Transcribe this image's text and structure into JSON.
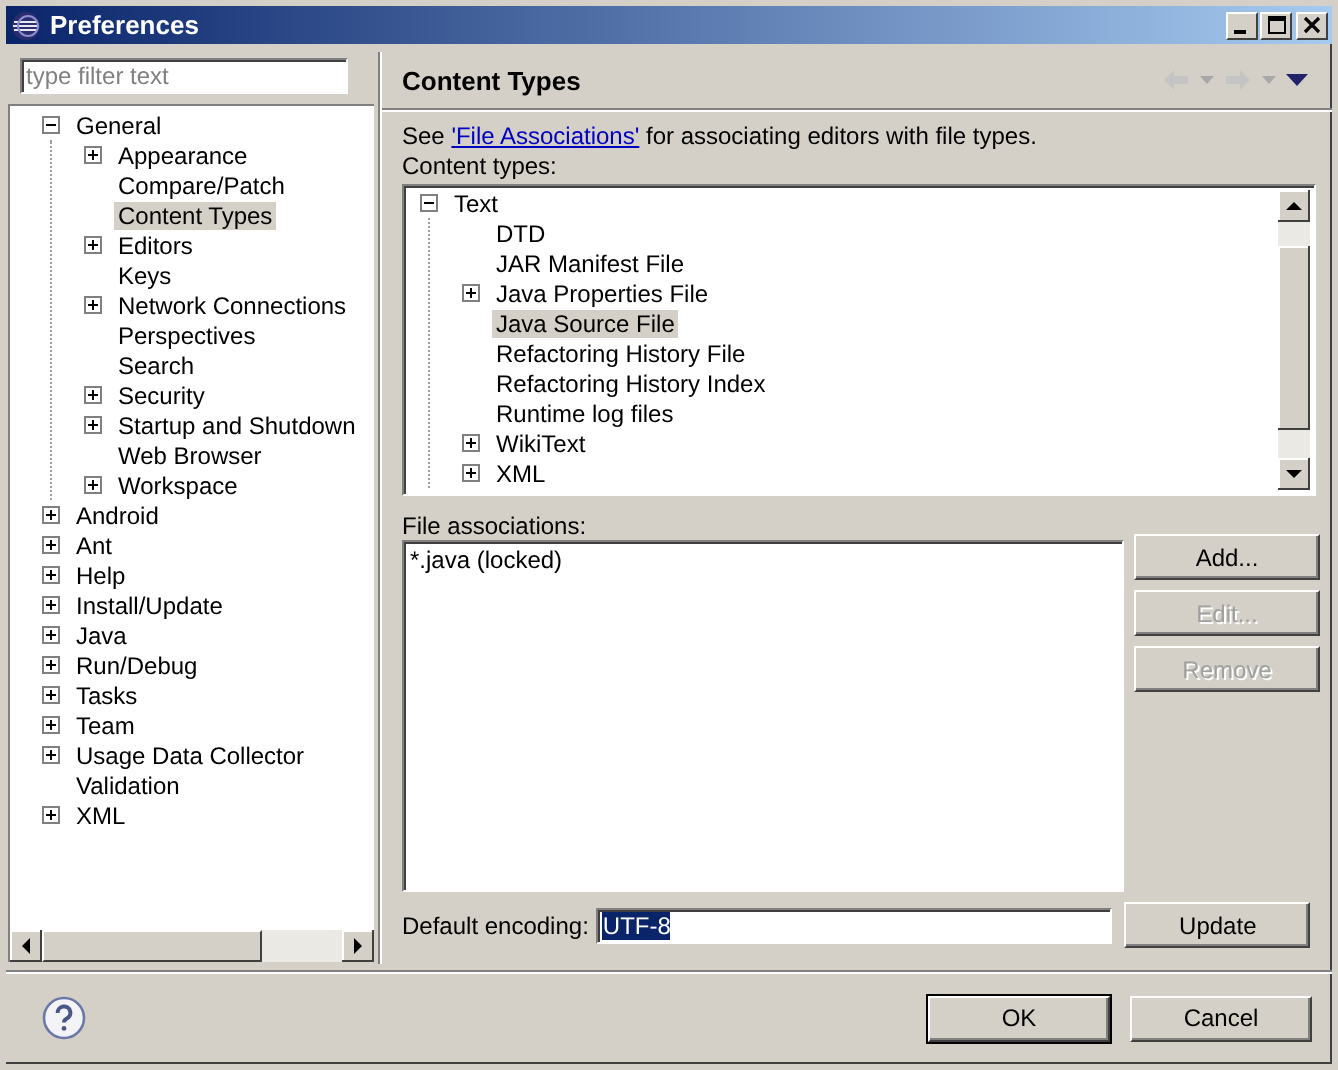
{
  "window": {
    "title": "Preferences"
  },
  "filter": {
    "placeholder": "type filter text"
  },
  "nav_tree": [
    {
      "label": "General",
      "expanded": true,
      "selected": false,
      "children": [
        {
          "label": "Appearance",
          "expandable": true,
          "selected": false
        },
        {
          "label": "Compare/Patch",
          "expandable": false,
          "selected": false
        },
        {
          "label": "Content Types",
          "expandable": false,
          "selected": true
        },
        {
          "label": "Editors",
          "expandable": true,
          "selected": false
        },
        {
          "label": "Keys",
          "expandable": false,
          "selected": false
        },
        {
          "label": "Network Connections",
          "expandable": true,
          "selected": false
        },
        {
          "label": "Perspectives",
          "expandable": false,
          "selected": false
        },
        {
          "label": "Search",
          "expandable": false,
          "selected": false
        },
        {
          "label": "Security",
          "expandable": true,
          "selected": false
        },
        {
          "label": "Startup and Shutdown",
          "expandable": true,
          "selected": false
        },
        {
          "label": "Web Browser",
          "expandable": false,
          "selected": false
        },
        {
          "label": "Workspace",
          "expandable": true,
          "selected": false
        }
      ]
    },
    {
      "label": "Android",
      "expandable": true,
      "selected": false
    },
    {
      "label": "Ant",
      "expandable": true,
      "selected": false
    },
    {
      "label": "Help",
      "expandable": true,
      "selected": false
    },
    {
      "label": "Install/Update",
      "expandable": true,
      "selected": false
    },
    {
      "label": "Java",
      "expandable": true,
      "selected": false
    },
    {
      "label": "Run/Debug",
      "expandable": true,
      "selected": false
    },
    {
      "label": "Tasks",
      "expandable": true,
      "selected": false
    },
    {
      "label": "Team",
      "expandable": true,
      "selected": false
    },
    {
      "label": "Usage Data Collector",
      "expandable": true,
      "selected": false
    },
    {
      "label": "Validation",
      "expandable": false,
      "selected": false
    },
    {
      "label": "XML",
      "expandable": true,
      "selected": false
    }
  ],
  "page": {
    "title": "Content Types",
    "intro": {
      "before": "See ",
      "link": "'File Associations'",
      "after": " for associating editors with file types."
    },
    "content_types_label": "Content types:",
    "content_tree": [
      {
        "label": "Text",
        "expanded": true,
        "selected": false,
        "children": [
          {
            "label": "DTD",
            "expandable": false,
            "selected": false
          },
          {
            "label": "JAR Manifest File",
            "expandable": false,
            "selected": false
          },
          {
            "label": "Java Properties File",
            "expandable": true,
            "selected": false
          },
          {
            "label": "Java Source File",
            "expandable": false,
            "selected": true
          },
          {
            "label": "Refactoring History File",
            "expandable": false,
            "selected": false
          },
          {
            "label": "Refactoring History Index",
            "expandable": false,
            "selected": false
          },
          {
            "label": "Runtime log files",
            "expandable": false,
            "selected": false
          },
          {
            "label": "WikiText",
            "expandable": true,
            "selected": false
          },
          {
            "label": "XML",
            "expandable": true,
            "selected": false
          }
        ]
      }
    ],
    "file_associations_label": "File associations:",
    "file_associations": [
      "*.java (locked)"
    ],
    "side_buttons": [
      {
        "label": "Add...",
        "disabled": false
      },
      {
        "label": "Edit...",
        "disabled": true
      },
      {
        "label": "Remove",
        "disabled": true
      }
    ],
    "encoding": {
      "label": "Default encoding:",
      "value": "UTF-8",
      "text_selected": true
    },
    "update_button": {
      "label": "Update",
      "disabled": false
    }
  },
  "buttons": [
    {
      "label": "OK",
      "default": true
    },
    {
      "label": "Cancel",
      "default": false
    }
  ]
}
